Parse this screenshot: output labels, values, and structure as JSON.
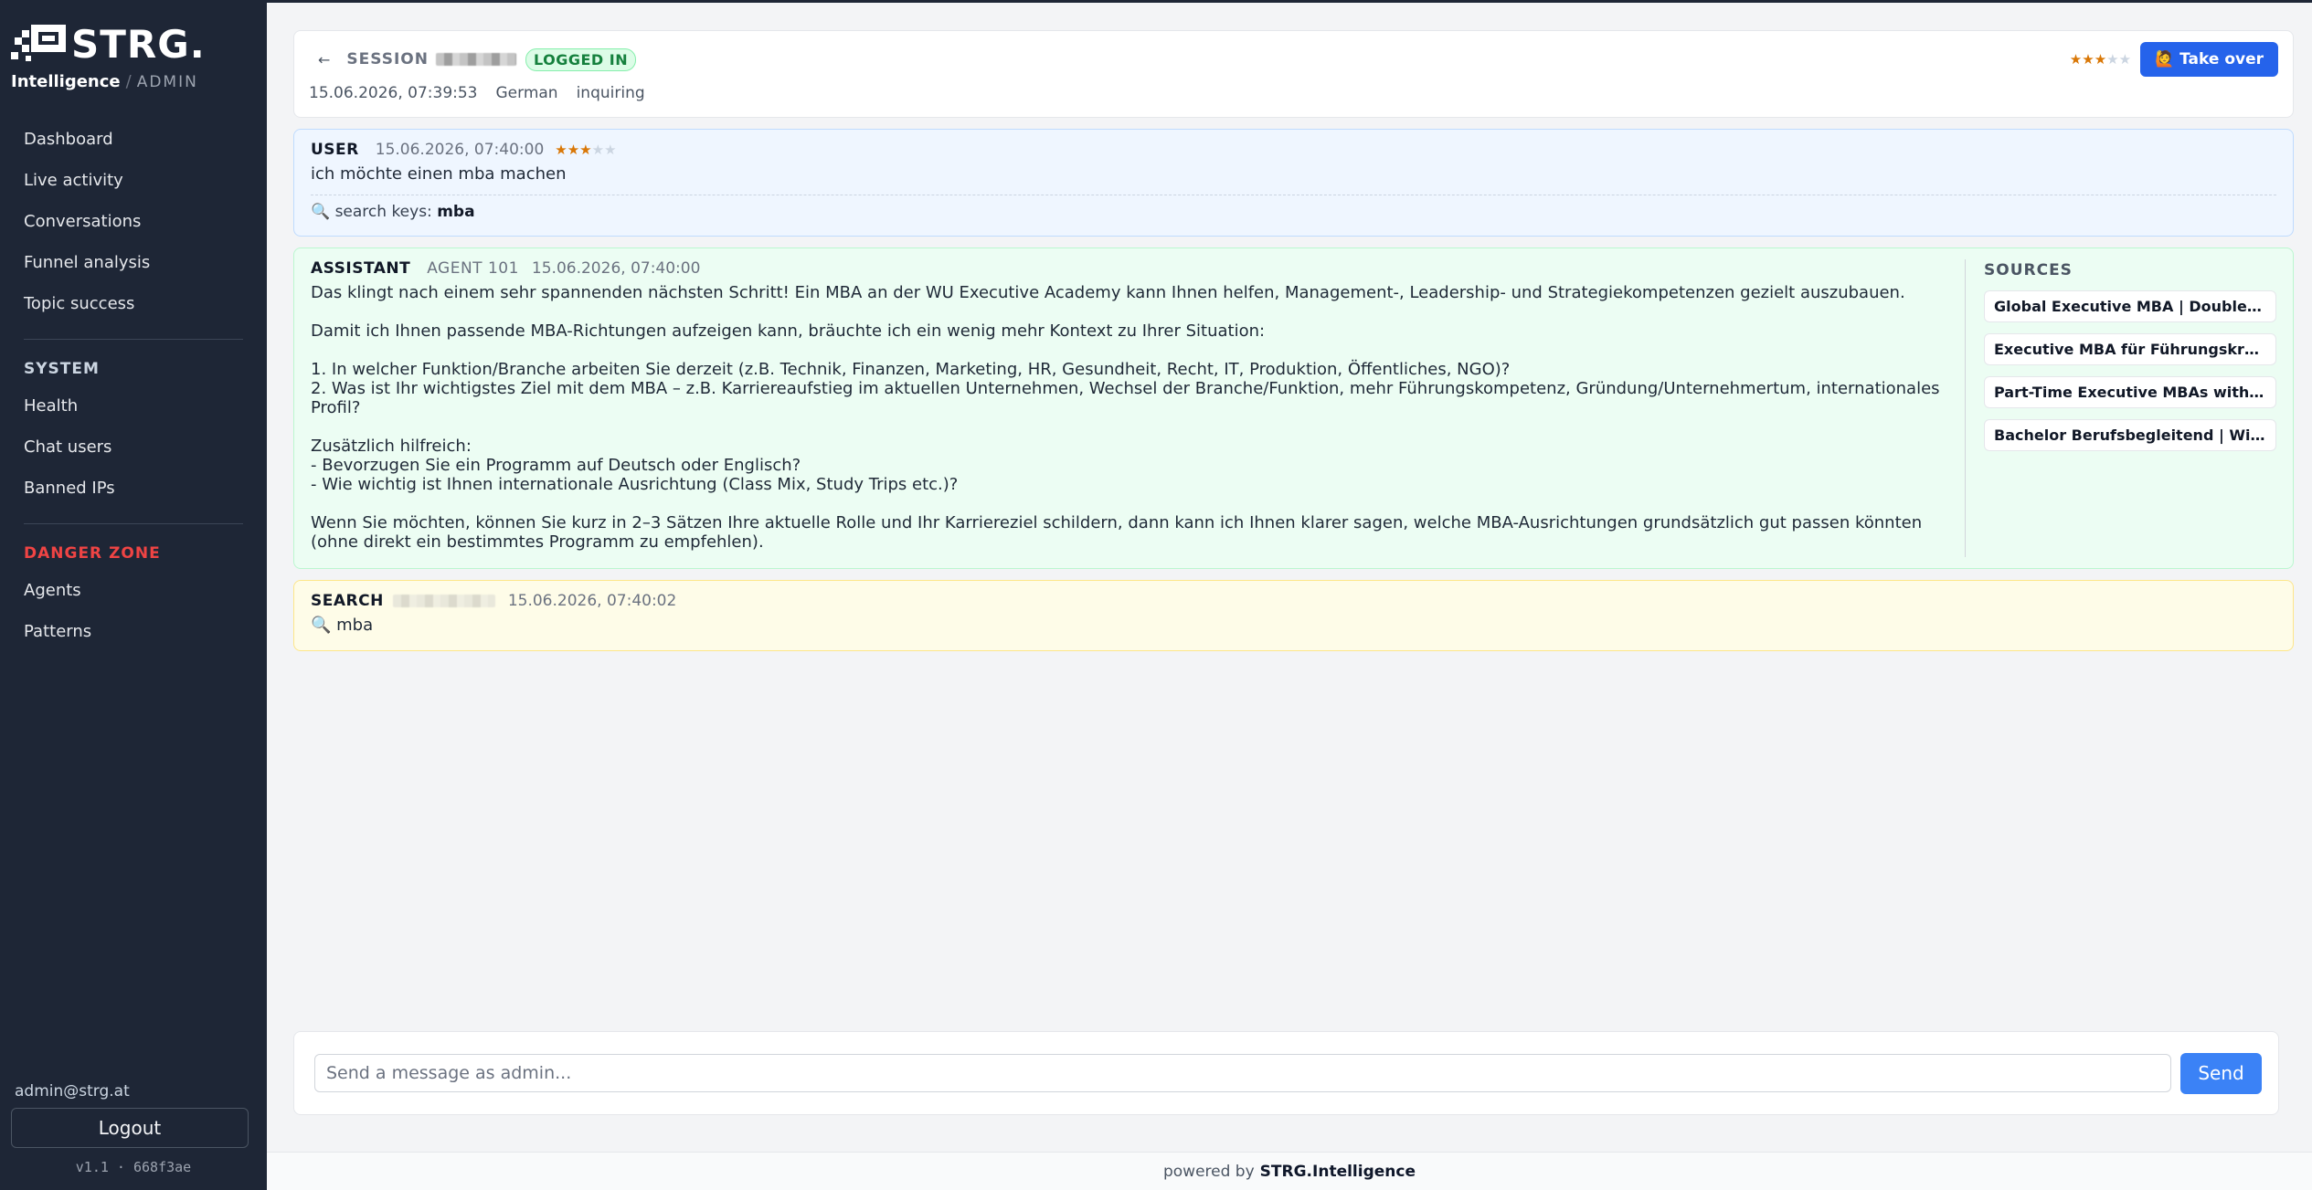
{
  "brand": {
    "word": "STRG.",
    "intelligence": "Intelligence",
    "slash": "/",
    "admin": "ADMIN"
  },
  "nav": {
    "items": [
      {
        "label": "Dashboard"
      },
      {
        "label": "Live activity"
      },
      {
        "label": "Conversations"
      },
      {
        "label": "Funnel analysis"
      },
      {
        "label": "Topic success"
      }
    ],
    "system_heading": "SYSTEM",
    "system_items": [
      {
        "label": "Health"
      },
      {
        "label": "Chat users"
      },
      {
        "label": "Banned IPs"
      }
    ],
    "danger_heading": "DANGER ZONE",
    "danger_items": [
      {
        "label": "Agents"
      },
      {
        "label": "Patterns"
      }
    ]
  },
  "account": {
    "email": "admin@strg.at",
    "logout_label": "Logout",
    "version": "v1.1 · 668f3ae"
  },
  "session": {
    "back_icon": "arrow-left-icon",
    "label": "SESSION",
    "status": "LOGGED IN",
    "rating": 3,
    "rating_max": 5,
    "takeover_label": "🙋 Take over",
    "started": "15.06.2026, 07:39:53",
    "language": "German",
    "intent": "inquiring"
  },
  "messages": {
    "user": {
      "role": "USER",
      "timestamp": "15.06.2026, 07:40:00",
      "rating": 3,
      "text": "ich möchte einen mba machen",
      "search_keys_label": "🔍 search keys:",
      "search_keys": "mba"
    },
    "assistant": {
      "role": "ASSISTANT",
      "agent": "AGENT 101",
      "timestamp": "15.06.2026, 07:40:00",
      "text": "Das klingt nach einem sehr spannenden nächsten Schritt! Ein MBA an der WU Executive Academy kann Ihnen helfen, Management-, Leadership- und Strategiekompetenzen gezielt auszubauen.\n\nDamit ich Ihnen passende MBA-Richtungen aufzeigen kann, bräuchte ich ein wenig mehr Kontext zu Ihrer Situation:\n\n1. In welcher Funktion/Branche arbeiten Sie derzeit (z.B. Technik, Finanzen, Marketing, HR, Gesundheit, Recht, IT, Produktion, Öffentliches, NGO)?\n2. Was ist Ihr wichtigstes Ziel mit dem MBA – z.B. Karriereaufstieg im aktuellen Unternehmen, Wechsel der Branche/Funktion, mehr Führungskompetenz, Gründung/Unternehmertum, internationales Profil?\n\nZusätzlich hilfreich:\n- Bevorzugen Sie ein Programm auf Deutsch oder Englisch?\n- Wie wichtig ist Ihnen internationale Ausrichtung (Class Mix, Study Trips etc.)?\n\nWenn Sie möchten, können Sie kurz in 2–3 Sätzen Ihre aktuelle Rolle und Ihr Karriereziel schildern, dann kann ich Ihnen klarer sagen, welche MBA-Ausrichtungen grundsätzlich gut passen könnten (ohne direkt ein bestimmtes Programm zu empfehlen).",
      "sources_title": "SOURCES",
      "sources": [
        {
          "label": "Global Executive MBA | Double Degree"
        },
        {
          "label": "Executive MBA für Führungskräfte | WU"
        },
        {
          "label": "Part-Time Executive MBAs with a Global"
        },
        {
          "label": "Bachelor Berufsbegleitend | Wirtschaft"
        }
      ]
    },
    "search": {
      "role": "SEARCH",
      "timestamp": "15.06.2026, 07:40:02",
      "query": "🔍 mba"
    }
  },
  "composer": {
    "placeholder": "Send a message as admin...",
    "send_label": "Send"
  },
  "footer": {
    "powered_by": "powered by",
    "brand": "STRG.Intelligence"
  },
  "colors": {
    "sidebar_bg": "#1e2636",
    "accent": "#2563eb",
    "danger": "#ef4444",
    "star": "#d97706"
  }
}
